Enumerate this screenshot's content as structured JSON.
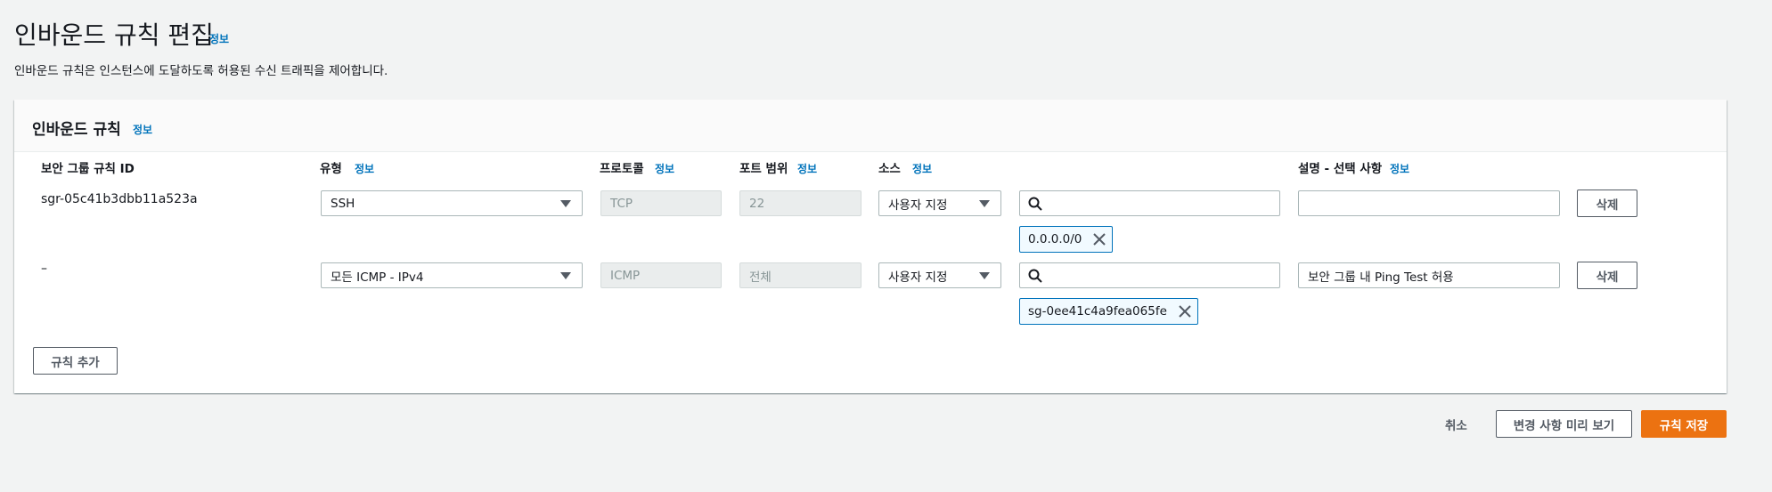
{
  "page": {
    "title": "인바운드 규칙 편집",
    "info": "정보",
    "description": "인바운드 규칙은 인스턴스에 도달하도록 허용된 수신 트래픽을 제어합니다."
  },
  "panel": {
    "title": "인바운드 규칙",
    "info": "정보",
    "columns": {
      "rule_id": "보안 그룹 규칙 ID",
      "type": "유형",
      "protocol": "프로토콜",
      "port_range": "포트 범위",
      "source": "소스",
      "description": "설명 - 선택 사항",
      "info": "정보"
    },
    "rules": [
      {
        "rule_id": "sgr-05c41b3dbb11a523a",
        "type": "SSH",
        "protocol": "TCP",
        "port_range": "22",
        "source_type": "사용자 지정",
        "search_value": "",
        "token": "0.0.0.0/0",
        "description": "",
        "delete_label": "삭제"
      },
      {
        "rule_id": "–",
        "type": "모든 ICMP - IPv4",
        "protocol": "ICMP",
        "port_range": "전체",
        "source_type": "사용자 지정",
        "search_value": "",
        "token": "sg-0ee41c4a9fea065fe",
        "description": "보안 그룹 내 Ping Test 허용",
        "delete_label": "삭제"
      }
    ],
    "add_rule_label": "규칙 추가"
  },
  "footer": {
    "cancel_label": "취소",
    "preview_label": "변경 사항 미리 보기",
    "save_label": "규칙 저장"
  },
  "colors": {
    "primary": "#ec7211",
    "link": "#0073bb",
    "token_border": "#0073bb"
  }
}
